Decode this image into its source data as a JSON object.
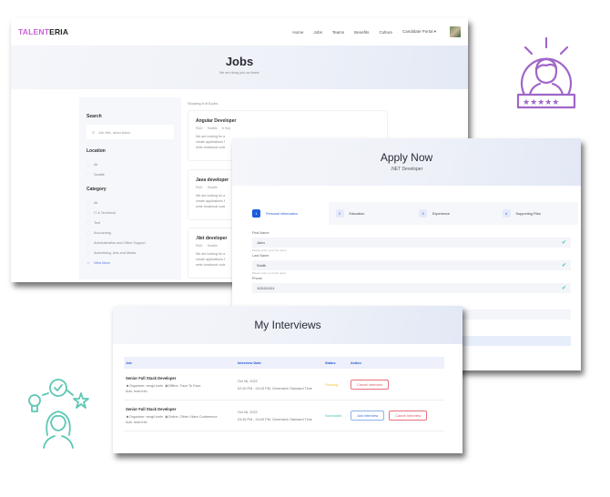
{
  "jobs_page": {
    "brand": {
      "part1": "TALENT",
      "part2": "ERIA"
    },
    "nav": [
      "Home",
      "Jobs",
      "Teams",
      "Benefits",
      "Culture",
      "Candidate Portal"
    ],
    "hero": {
      "title": "Jobs",
      "subtitle": "We are hiring join our team!"
    },
    "sidebar": {
      "search_heading": "Search",
      "search_placeholder": "Job title, description",
      "location_heading": "Location",
      "locations": [
        "All",
        "Seattle"
      ],
      "category_heading": "Category",
      "categories": [
        "All",
        "IT & Technical",
        "Test",
        "Accounting",
        "Administration and Office Support",
        "Advertising, Arts and Media"
      ],
      "view_more": "View More"
    },
    "showing": "Showing 8 of 8 jobs",
    "jobs": [
      {
        "title": "Angular Developer",
        "meta": [
          "R&D",
          "Seattle",
          "8 Sep"
        ],
        "desc": [
          "We are looking for a",
          "create applications fr",
          "write functional code"
        ]
      },
      {
        "title": "Java developer",
        "meta": [
          "R&D",
          "Seattle"
        ],
        "desc": [
          "We are looking for a",
          "create applications fr",
          "write functional code"
        ]
      },
      {
        "title": ".Net developer",
        "meta": [
          "R&D",
          "Seattle"
        ],
        "desc": [
          "We are looking for a",
          "create applications fr",
          "write functional code"
        ]
      }
    ]
  },
  "apply_page": {
    "title": "Apply Now",
    "subtitle": ".NET Developer",
    "steps": [
      {
        "num": "1",
        "label": "Personal information"
      },
      {
        "num": "2",
        "label": "Education"
      },
      {
        "num": "3",
        "label": "Experience"
      },
      {
        "num": "4",
        "label": "Supporting Files"
      }
    ],
    "fields": [
      {
        "label": "First Name",
        "value": "John",
        "hint": "Please enter your first name"
      },
      {
        "label": "Last Name",
        "value": "Smith",
        "hint": "Please enter your last name"
      },
      {
        "label": "Phone",
        "value": "1111111111",
        "hint": ""
      }
    ]
  },
  "interviews_page": {
    "title": "My Interviews",
    "columns": [
      "Job",
      "Interview Date",
      "Status",
      "Action"
    ],
    "rows": [
      {
        "job": "Senior Full Stack Developer",
        "organizer": "Organizer: sergii korle",
        "location": "Offline, Face To Face",
        "extra": "Add. read info",
        "date": "Oct 06, 2022",
        "time": "02:30 PM - 03:15 PM, Greenwich Standard Time",
        "status": "Pending",
        "actions": [
          "Cancel interview"
        ]
      },
      {
        "job": "Senior Full Stack Developer",
        "organizer": "Organizer: sergii korle",
        "location": "Online, Other Video Conference",
        "extra": "Add. read info",
        "date": "Oct 06, 2022",
        "time": "03:45 PM - 04:00 PM, Greenwich Standard Time",
        "status": "Scheduled",
        "actions": [
          "Join Interview",
          "Cancel Interview"
        ]
      }
    ]
  },
  "decorations": {
    "top_right_icon": "rated-candidate-icon",
    "bottom_left_icon": "idea-to-goal-person-icon",
    "colors": {
      "purple": "#a066c8",
      "teal": "#5cc8b4",
      "accent": "#1a5ce0"
    }
  }
}
